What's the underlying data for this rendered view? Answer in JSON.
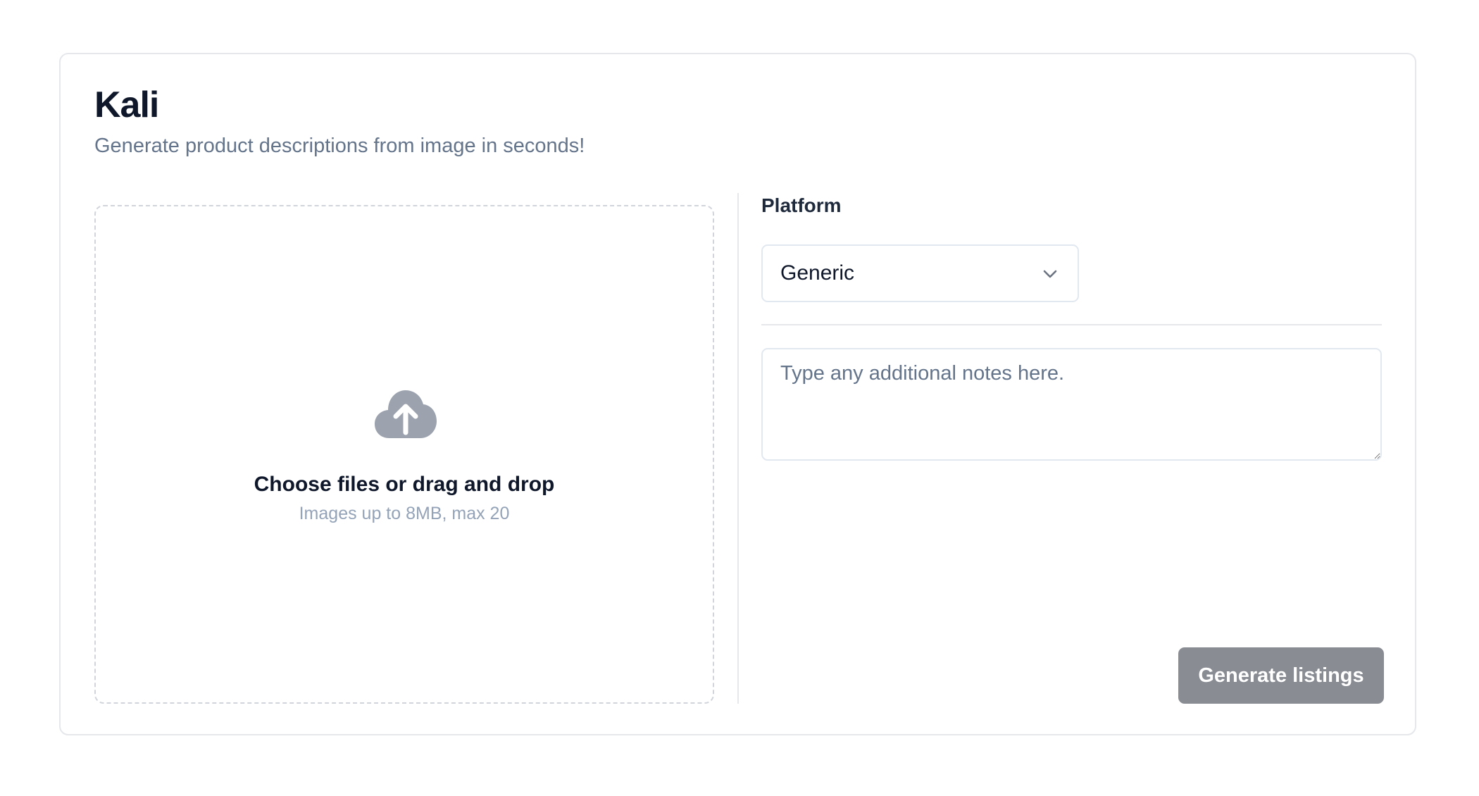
{
  "app": {
    "title": "Kali",
    "subtitle": "Generate product descriptions from image in seconds!"
  },
  "upload": {
    "title": "Choose files or drag and drop",
    "hint": "Images up to 8MB, max 20",
    "icon": "cloud-upload-icon"
  },
  "platform": {
    "label": "Platform",
    "selected": "Generic",
    "icon": "chevron-down-icon"
  },
  "notes": {
    "placeholder": "Type any additional notes here.",
    "value": ""
  },
  "actions": {
    "generate_label": "Generate listings"
  },
  "colors": {
    "button_bg": "#8a8c94",
    "title": "#0f172a",
    "subtitle": "#64748b",
    "icon": "#9ca3af"
  }
}
